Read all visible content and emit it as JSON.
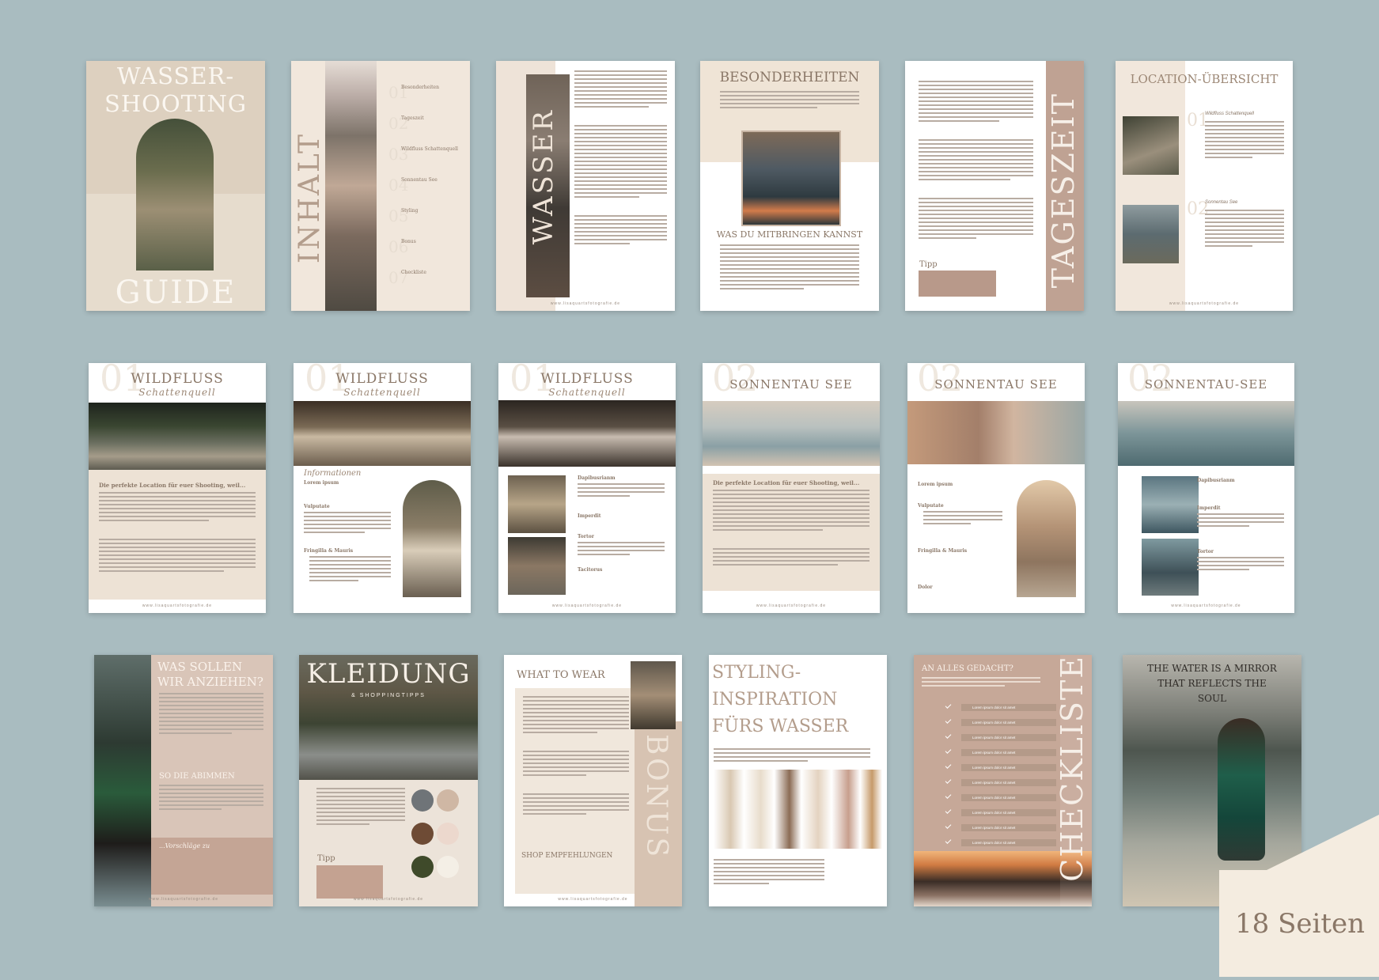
{
  "colors": {
    "background": "#a9bcc0",
    "beige": "#e8dccd",
    "taupe": "#c2a594",
    "deep_taupe": "#a88b7a",
    "text": "#8a7767"
  },
  "p1": {
    "title_top": "WASSER-",
    "title_mid": "SHOOTING",
    "title_bottom": "GUIDE"
  },
  "p2": {
    "title": "INHALT",
    "items": [
      {
        "num": "01",
        "label": "Besonderheiten"
      },
      {
        "num": "02",
        "label": "Tageszeit"
      },
      {
        "num": "03",
        "label": "Wildfluss Schattenquell"
      },
      {
        "num": "04",
        "label": "Sonnentau See"
      },
      {
        "num": "05",
        "label": "Styling"
      },
      {
        "num": "06",
        "label": "Bonus"
      },
      {
        "num": "07",
        "label": "Checkliste"
      }
    ]
  },
  "p3": {
    "title": "WASSER"
  },
  "p4": {
    "title": "BESONDERHEITEN",
    "subtitle": "WAS DU MITBRINGEN KANNST"
  },
  "p5": {
    "title": "TAGESZEIT",
    "tip": "Tipp"
  },
  "p6": {
    "title": "LOCATION-ÜBERSICHT",
    "n1": "01",
    "l1": "Wildfluss Schattenquell",
    "n2": "02",
    "l2": "Sonnentau See"
  },
  "p7": {
    "num": "01",
    "title": "WILDFLUSS",
    "script": "Schattenquell",
    "lead": "Die perfekte Location für euer Shooting, weil..."
  },
  "p8": {
    "num": "01",
    "title": "WILDFLUSS",
    "script": "Schattenquell",
    "info": "Informationen",
    "h1": "Lorem ipsum",
    "h2": "Vulputate",
    "h3": "Fringilla & Mauris"
  },
  "p9": {
    "num": "01",
    "title": "WILDFLUSS",
    "script": "Schattenquell",
    "h1": "Dapibusrianm",
    "h2": "Imperdit",
    "h3": "Tortor",
    "h4": "Tacitorus"
  },
  "p10": {
    "num": "02",
    "title": "SONNENTAU SEE",
    "lead": "Die perfekte Location für euer Shooting, weil..."
  },
  "p11": {
    "num": "02",
    "title": "SONNENTAU SEE",
    "h1": "Lorem ipsum",
    "h2": "Vulputate",
    "h3": "Fringilla & Mauris",
    "h4": "Dolor"
  },
  "p12": {
    "num": "02",
    "title": "SONNENTAU-SEE",
    "h1": "Dapibusrianm",
    "h2": "Imperdit",
    "h3": "Tortor"
  },
  "p13": {
    "title_a": "WAS SOLLEN",
    "title_b": "WIR ANZIEHEN?",
    "sub": "SO DIE ABIMMEN",
    "script": "...Vorschläge zu"
  },
  "p14": {
    "title": "KLEIDUNG",
    "sub": "& SHOPPINGTIPPS",
    "tip": "Tipp",
    "palette": [
      "#6f7478",
      "#cfb7a4",
      "#6e4b35",
      "#ecd8cd",
      "#3f4a2a",
      "#f4efe6"
    ]
  },
  "p15": {
    "title": "WHAT TO WEAR",
    "side": "BONUS",
    "shop": "SHOP EMPFEHLUNGEN"
  },
  "p16": {
    "line1": "STYLING-",
    "line2": "INSPIRATION",
    "line3": "FÜRS WASSER"
  },
  "p17": {
    "head": "AN ALLES GEDACHT?",
    "side": "CHECKLISTE",
    "items": [
      "Lorem ipsum dolor sit amet",
      "Lorem ipsum dolor sit amet",
      "Lorem ipsum dolor sit amet",
      "Lorem ipsum dolor sit amet",
      "Lorem ipsum dolor sit amet",
      "Lorem ipsum dolor sit amet",
      "Lorem ipsum dolor sit amet",
      "Lorem ipsum dolor sit amet",
      "Lorem ipsum dolor sit amet",
      "Lorem ipsum dolor sit amet"
    ]
  },
  "p18": {
    "quote_1": "THE WATER IS A MIRROR",
    "quote_2": "THAT REFLECTS THE",
    "quote_3": "SOUL"
  },
  "footer_url": "www.lisaquartsfotografie.de",
  "badge": "18 Seiten"
}
